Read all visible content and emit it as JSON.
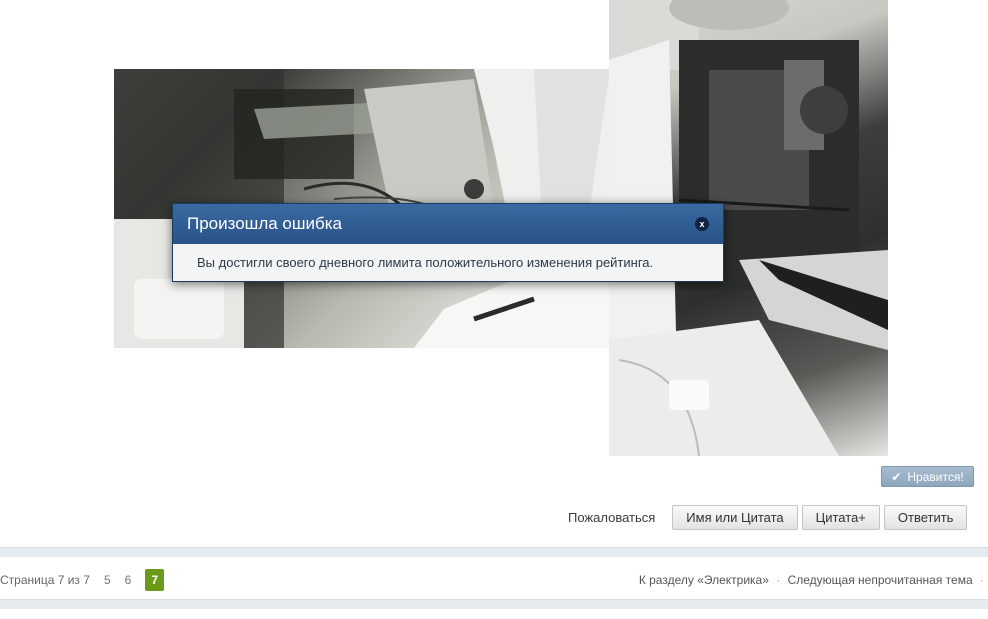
{
  "modal": {
    "title": "Произошла ошибка",
    "message": "Вы достигли своего дневного лимита положительного изменения рейтинга.",
    "close_glyph": "x"
  },
  "like_button": {
    "label": "Нравится!",
    "icon": "check-icon"
  },
  "actions": {
    "report_label": "Пожаловаться",
    "quote_name_label": "Имя или Цитата",
    "multiquote_label": "Цитата+",
    "reply_label": "Ответить"
  },
  "pagination": {
    "label": "Страница 7 из 7",
    "pages": [
      "5",
      "6",
      "7"
    ],
    "current": "7"
  },
  "breadcrumbs": {
    "section_link": "К разделу «Электрика»",
    "next_unread": "Следующая непрочитанная тема"
  },
  "colors": {
    "modal_header": "#2a5288",
    "current_page": "#6a9a18",
    "like_button": "#8ea6bd"
  }
}
